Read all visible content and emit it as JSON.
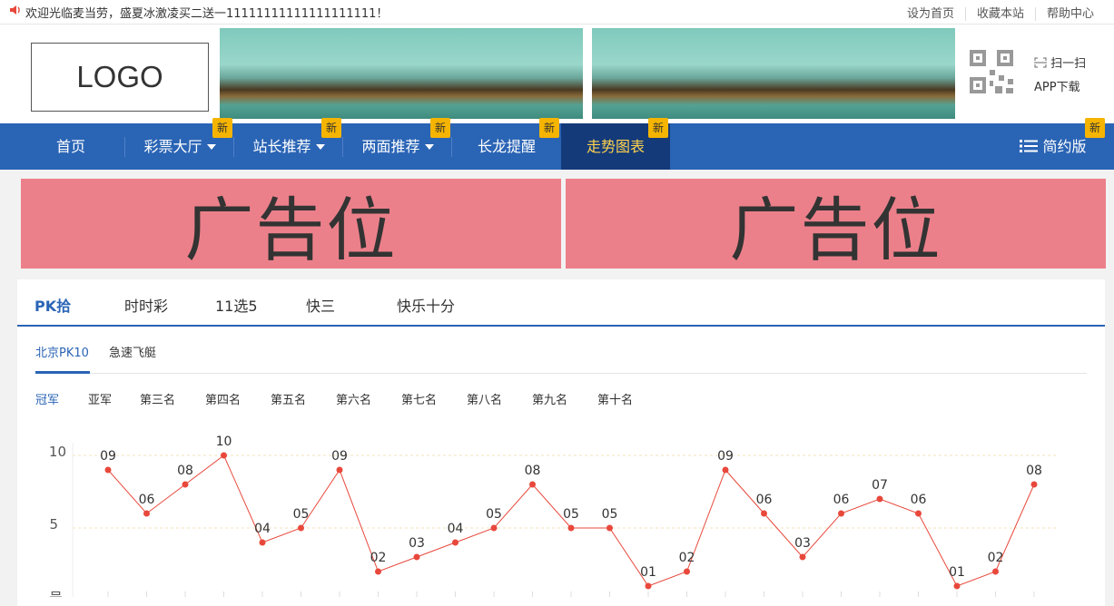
{
  "topbar": {
    "notice": "欢迎光临麦当劳，盛夏冰激凌买二送一11111111111111111111！",
    "links": [
      "设为首页",
      "收藏本站",
      "帮助中心"
    ]
  },
  "header": {
    "logo_text": "LOGO",
    "scan_label": "扫一扫",
    "app_download": "APP下载"
  },
  "nav": {
    "items": [
      {
        "label": "首页",
        "dropdown": false,
        "badge": ""
      },
      {
        "label": "彩票大厅",
        "dropdown": true,
        "badge": "新"
      },
      {
        "label": "站长推荐",
        "dropdown": true,
        "badge": "新"
      },
      {
        "label": "两面推荐",
        "dropdown": true,
        "badge": "新"
      },
      {
        "label": "长龙提醒",
        "dropdown": false,
        "badge": "新"
      },
      {
        "label": "走势图表",
        "dropdown": false,
        "badge": "新",
        "active": true
      }
    ],
    "simple_label": "简约版",
    "simple_badge": "新"
  },
  "ads": [
    "广告位",
    "广告位"
  ],
  "lottery_tabs": [
    "PK拾",
    "时时彩",
    "11选5",
    "快三",
    "快乐十分"
  ],
  "sub_tabs": [
    "北京PK10",
    "急速飞艇"
  ],
  "rank_tabs": [
    "冠军",
    "亚军",
    "第三名",
    "第四名",
    "第五名",
    "第六名",
    "第七名",
    "第八名",
    "第九名",
    "第十名"
  ],
  "chart_data": {
    "type": "line",
    "y_ticks": [
      "10",
      "5"
    ],
    "ylim": [
      0,
      10
    ],
    "ylabel_partial": "号",
    "series": [
      {
        "values": [
          9,
          6,
          8,
          10,
          4,
          5,
          9,
          2,
          3,
          4,
          5,
          8,
          5,
          5,
          1,
          2,
          9,
          6,
          3,
          6,
          7,
          6,
          1,
          2,
          8
        ],
        "labels": [
          "09",
          "06",
          "08",
          "10",
          "04",
          "05",
          "09",
          "02",
          "03",
          "04",
          "05",
          "08",
          "05",
          "05",
          "01",
          "02",
          "09",
          "06",
          "03",
          "06",
          "07",
          "06",
          "01",
          "02",
          "08"
        ]
      }
    ],
    "color": "#e8483b"
  }
}
